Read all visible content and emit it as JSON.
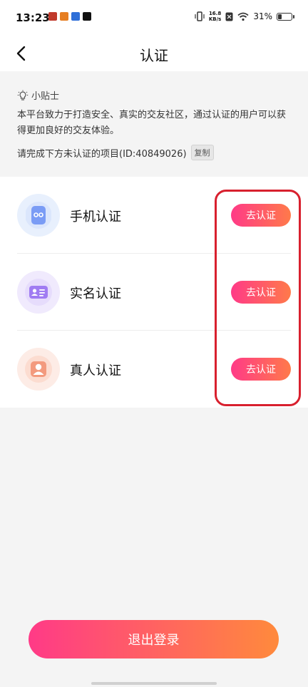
{
  "status": {
    "time": "13:23",
    "net_speed_value": "16.8",
    "net_speed_unit": "KB/s",
    "battery": "31%",
    "battery_level": 0.31,
    "apps": [
      "gallery-app-icon",
      "news-app-icon",
      "browser-app-icon",
      "tiktok-app-icon"
    ]
  },
  "nav": {
    "back_icon": "chevron-left-icon",
    "title": "认证"
  },
  "tips": {
    "heading": "小贴士",
    "body": "本平台致力于打造安全、真实的交友社区，通过认证的用户可以获得更加良好的交友体验。",
    "id_prompt": "请完成下方未认证的项目(ID:40849026)",
    "copy_label": "复制"
  },
  "items": [
    {
      "label": "手机认证",
      "button": "去认证",
      "icon": "phone-icon",
      "bg": "#e8f0fd",
      "color": "#7a9cf5"
    },
    {
      "label": "实名认证",
      "button": "去认证",
      "icon": "id-card-icon",
      "bg": "#f0eafd",
      "color": "#a07cf2"
    },
    {
      "label": "真人认证",
      "button": "去认证",
      "icon": "person-icon",
      "bg": "#fdece6",
      "color": "#f39a7e"
    }
  ],
  "logout": {
    "label": "退出登录"
  },
  "colors": {
    "accent_start": "#ff3a87",
    "accent_end": "#ff7a4a",
    "highlight": "#d8202e"
  }
}
